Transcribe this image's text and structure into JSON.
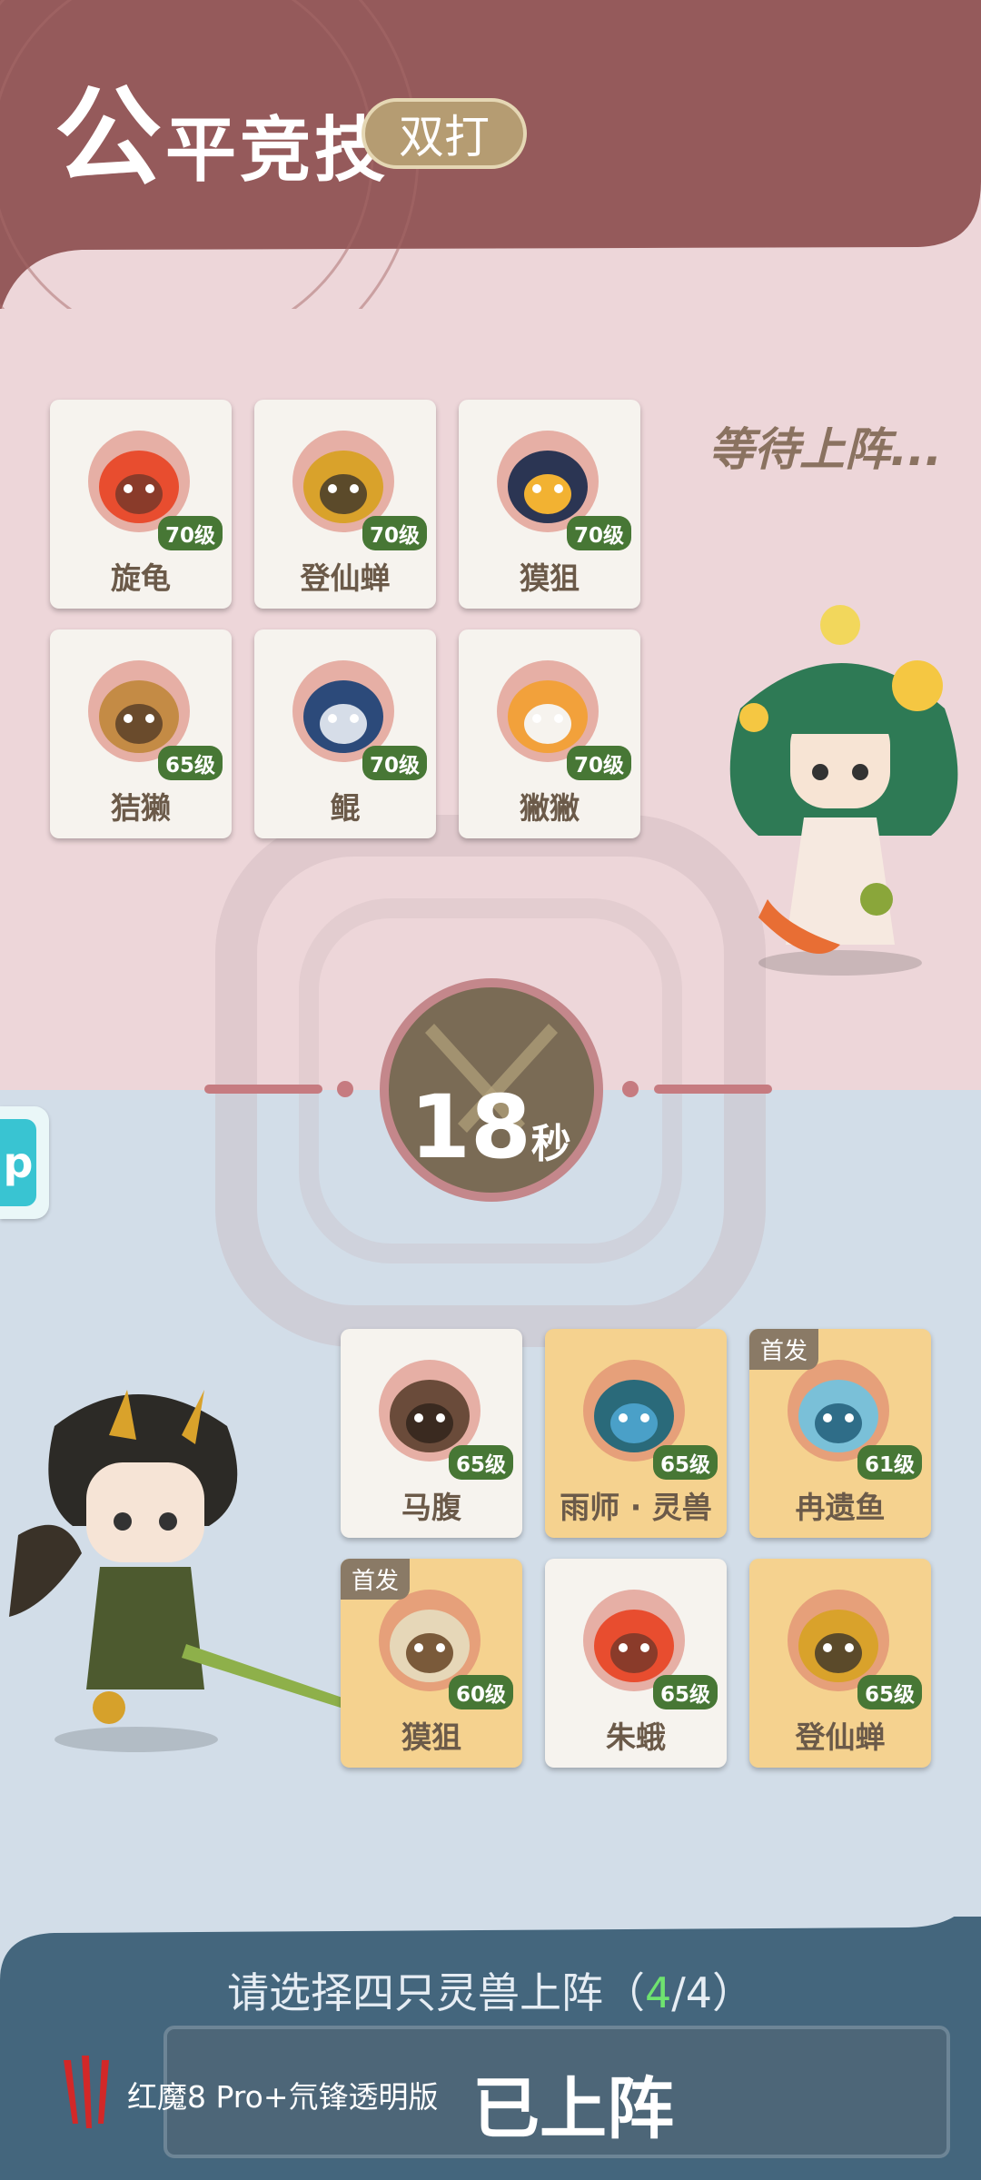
{
  "header": {
    "title_big": "公",
    "title_rest": "平竞技",
    "mode": "双打"
  },
  "opponent": {
    "status": "等待上阵...",
    "cards": [
      {
        "name": "旋龟",
        "level": "70级",
        "icon": "fire-turtle-icon"
      },
      {
        "name": "登仙蝉",
        "level": "70级",
        "icon": "gold-cicada-icon"
      },
      {
        "name": "獏狙",
        "level": "70级",
        "icon": "dark-beast-icon"
      },
      {
        "name": "狤獭",
        "level": "65级",
        "icon": "straw-hat-otter-icon"
      },
      {
        "name": "鲲",
        "level": "70级",
        "icon": "whale-icon"
      },
      {
        "name": "獙獙",
        "level": "70级",
        "icon": "fox-icon"
      }
    ]
  },
  "timer": {
    "value": "18",
    "unit": "秒"
  },
  "player": {
    "cards": [
      {
        "name": "马腹",
        "level": "65级",
        "selected": false,
        "tag": "",
        "icon": "tiger-icon"
      },
      {
        "name": "雨师 · 灵兽",
        "level": "65级",
        "selected": true,
        "tag": "",
        "icon": "rain-dragon-icon"
      },
      {
        "name": "冉遗鱼",
        "level": "61级",
        "selected": true,
        "tag": "首发",
        "icon": "fish-icon"
      },
      {
        "name": "獏狙",
        "level": "60级",
        "selected": true,
        "tag": "首发",
        "icon": "dark-beast-icon"
      },
      {
        "name": "朱蛾",
        "level": "65级",
        "selected": false,
        "tag": "",
        "icon": "moth-icon"
      },
      {
        "name": "登仙蝉",
        "level": "65级",
        "selected": true,
        "tag": "",
        "icon": "gold-cicada-icon"
      }
    ]
  },
  "footer": {
    "instruction_prefix": "请选择四只灵兽上阵（",
    "count": "4",
    "instruction_suffix": "/4）",
    "confirm_label": "已上阵",
    "device": "红魔8 Pro+氘锋透明版"
  },
  "side_tab": {
    "label": "p"
  },
  "colors": {
    "header": "#955a5b",
    "pink_bg": "#edd6d9",
    "blue_bg": "#d2dde8",
    "footer": "#44667d",
    "level_badge": "#477735",
    "selected_card": "#f5d28f"
  }
}
